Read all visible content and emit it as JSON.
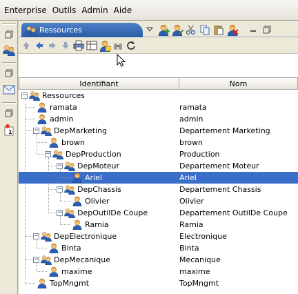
{
  "menu": [
    "Enterprise",
    "Outils",
    "Admin",
    "Aide"
  ],
  "panel": {
    "tab_label": "Ressources"
  },
  "table": {
    "headers": [
      "Identifiant",
      "Nom"
    ]
  },
  "tree": [
    {
      "id": "Ressources",
      "nom": "",
      "type": "root",
      "depth": 0,
      "expanded": true
    },
    {
      "id": "ramata",
      "nom": "ramata",
      "type": "user",
      "depth": 1
    },
    {
      "id": "admin",
      "nom": "admin",
      "type": "user",
      "depth": 1
    },
    {
      "id": "DepMarketing",
      "nom": "Departement Marketing",
      "type": "group",
      "depth": 1,
      "expanded": true
    },
    {
      "id": "brown",
      "nom": "brown",
      "type": "user",
      "depth": 2
    },
    {
      "id": "DepProduction",
      "nom": "Production",
      "type": "group",
      "depth": 2,
      "expanded": true
    },
    {
      "id": "DepMoteur",
      "nom": "Departement Moteur",
      "type": "group",
      "depth": 3,
      "expanded": true
    },
    {
      "id": "Ariel",
      "nom": "Ariel",
      "type": "user",
      "depth": 4,
      "selected": true
    },
    {
      "id": "DepChassis",
      "nom": "Departement Chassis",
      "type": "group",
      "depth": 3,
      "expanded": true
    },
    {
      "id": "Olivier",
      "nom": "Olivier",
      "type": "user",
      "depth": 4
    },
    {
      "id": "DepOutilDe Coupe",
      "nom": "Departement OutilDe Coupe",
      "type": "group",
      "depth": 3,
      "expanded": true
    },
    {
      "id": "Ramia",
      "nom": "Ramia",
      "type": "user",
      "depth": 4
    },
    {
      "id": "DepElectronique",
      "nom": "Electronique",
      "type": "group",
      "depth": 1,
      "expanded": true
    },
    {
      "id": "Binta",
      "nom": "Binta",
      "type": "user",
      "depth": 2
    },
    {
      "id": "DepMecanique",
      "nom": "Mecanique",
      "type": "group",
      "depth": 1,
      "expanded": true
    },
    {
      "id": "maxime",
      "nom": "maxime",
      "type": "user",
      "depth": 2
    },
    {
      "id": "TopMngmt",
      "nom": "TopMngmt",
      "type": "user",
      "depth": 1
    }
  ],
  "colors": {
    "selection": "#3a6ec8",
    "tab": "#2a5ba6",
    "chrome": "#ece9d8"
  }
}
